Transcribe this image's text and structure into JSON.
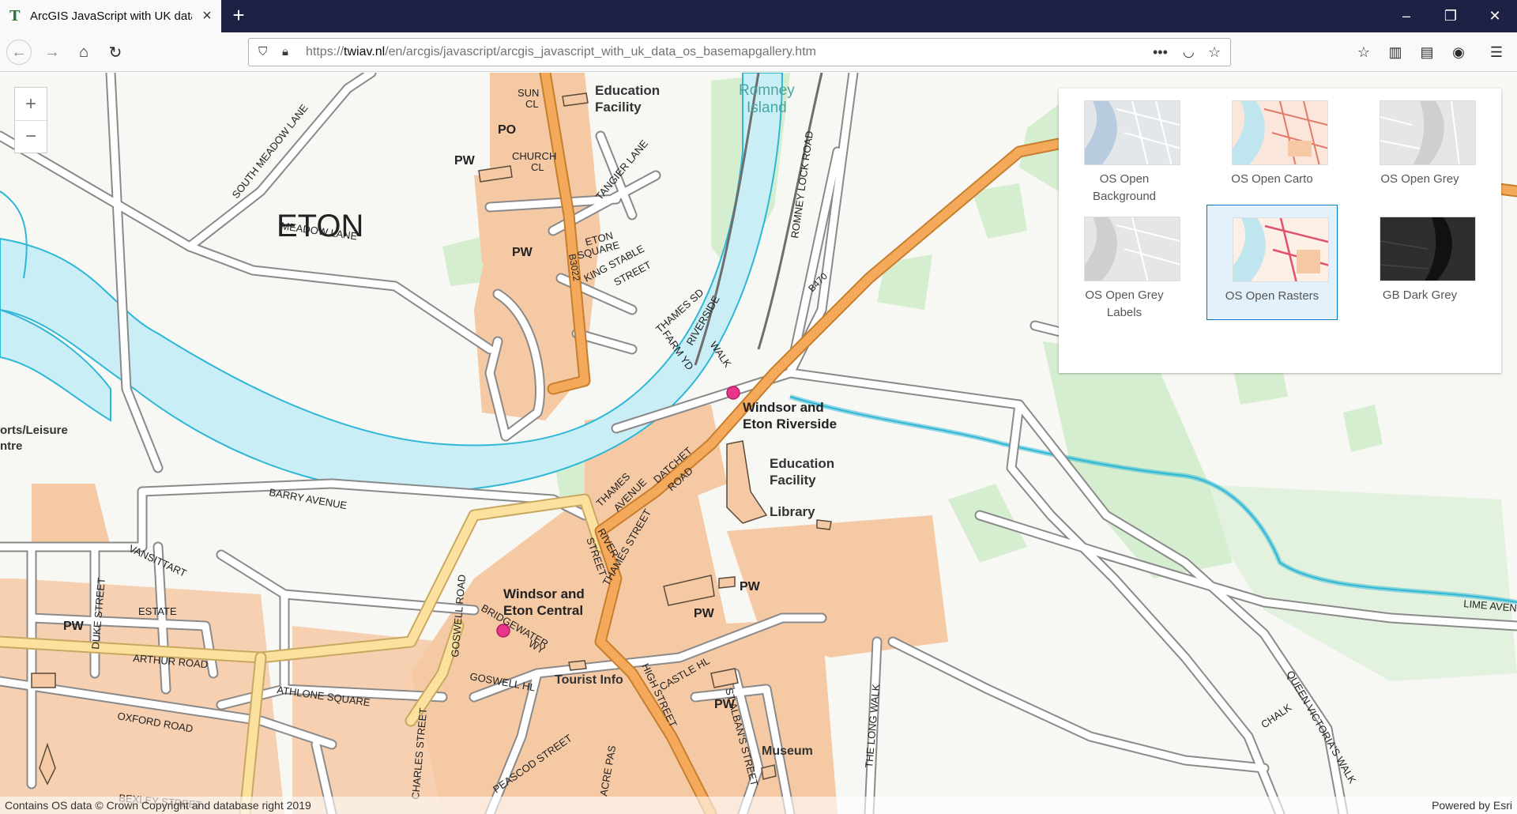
{
  "browser": {
    "tab_title": "ArcGIS JavaScript with UK data",
    "tab_favicon": "T",
    "url_prefix": "https://",
    "url_domain": "twiav.nl",
    "url_path": "/en/arcgis/javascript/arcgis_javascript_with_uk_data_os_basemapgallery.htm"
  },
  "map": {
    "zoom_in": "+",
    "zoom_out": "−",
    "labels": {
      "eton": "ETON",
      "romney_island_1": "Romney",
      "romney_island_2": "Island",
      "education_facility_top_1": "Education",
      "education_facility_top_2": "Facility",
      "sun_cl_1": "SUN",
      "sun_cl_2": "CL",
      "po": "PO",
      "church_cl_1": "CHURCH",
      "church_cl_2": "CL",
      "pw_1": "PW",
      "pw_2": "PW",
      "pw_3": "PW",
      "pw_4": "PW",
      "pw_5": "PW",
      "pw_6": "PW",
      "south_meadow_lane": "SOUTH MEADOW LANE",
      "meadow_lane": "MEADOW LANE",
      "tangier_lane": "TANGIER LANE",
      "eton_square_1": "ETON",
      "eton_square_2": "SQUARE",
      "b3022": "B3022",
      "king_stable_1": "KING STABLE",
      "king_stable_2": "STREET",
      "romney_lock_road": "ROMNEY LOCK ROAD",
      "b470": "B470",
      "thames_sd": "THAMES SD",
      "farm_yd": "FARM YD",
      "riverside_walk_1": "RIVERSIDE",
      "riverside_walk_2": "WALK",
      "windsor_eton_riverside_1": "Windsor and",
      "windsor_eton_riverside_2": "Eton Riverside",
      "sports_leisure_1": "orts/Leisure",
      "sports_leisure_2": "ntre",
      "education_facility_mid_1": "Education",
      "education_facility_mid_2": "Facility",
      "library": "Library",
      "barry_avenue": "BARRY AVENUE",
      "thames_avenue_1": "THAMES",
      "thames_avenue_2": "AVENUE",
      "datchet_road_1": "DATCHET",
      "datchet_road_2": "ROAD",
      "river_street_1": "RIVER",
      "river_street_2": "STREET",
      "thames_street": "THAMES STREET",
      "vansittart_1": "VANSITTART",
      "vansittart_estate": "ESTATE",
      "duke_street": "DUKE STREET",
      "goswell_road": "GOSWELL ROAD",
      "windsor_eton_central_1": "Windsor and",
      "windsor_eton_central_2": "Eton Central",
      "bridgewater_1": "BRIDGEWATER",
      "bridgewater_2": "WY",
      "arthur_road": "ARTHUR ROAD",
      "goswell_hl": "GOSWELL HL",
      "tourist_info": "Tourist Info",
      "athlone_square": "ATHLONE SQUARE",
      "oxford_road": "OXFORD ROAD",
      "high_street": "HIGH STREET",
      "castle_hl": "CASTLE HL",
      "st_albans_street": "ST ALBAN'S STREET",
      "museum": "Museum",
      "peascod_street": "PEASCOD STREET",
      "acre_pas": "ACRE PAS",
      "charles_street": "CHARLES STREET",
      "bexley_street": "BEXLEY STREET",
      "vansittart_rd": "VANSITTAR",
      "the_long_walk": "THE LONG WALK",
      "chalk": "CHALK",
      "queen_victorias_walk": "QUEEN VICTORIA'S WALK",
      "lime_avenue": "LIME AVEN"
    }
  },
  "basemap_gallery": {
    "items": [
      {
        "label_1": "OS Open",
        "label_2": "Background",
        "selected": false
      },
      {
        "label_1": "OS Open Carto",
        "label_2": "",
        "selected": false
      },
      {
        "label_1": "OS Open Grey",
        "label_2": "",
        "selected": false
      },
      {
        "label_1": "OS Open Grey",
        "label_2": "Labels",
        "selected": false
      },
      {
        "label_1": "OS Open Rasters",
        "label_2": "",
        "selected": true
      },
      {
        "label_1": "GB Dark Grey",
        "label_2": "",
        "selected": false
      }
    ]
  },
  "attribution": {
    "left": "Contains OS data © Crown Copyright and database right 2019",
    "right": "Powered by Esri"
  },
  "colors": {
    "water": "#c9eef5",
    "water_edge": "#2fb7d6",
    "urban": "#f6c9a5",
    "a_road": "#f5a95a",
    "b_road": "#fbe19d",
    "green": "#d6eed0",
    "selected_border": "#0079c1",
    "selected_bg": "#e2f1fb"
  }
}
